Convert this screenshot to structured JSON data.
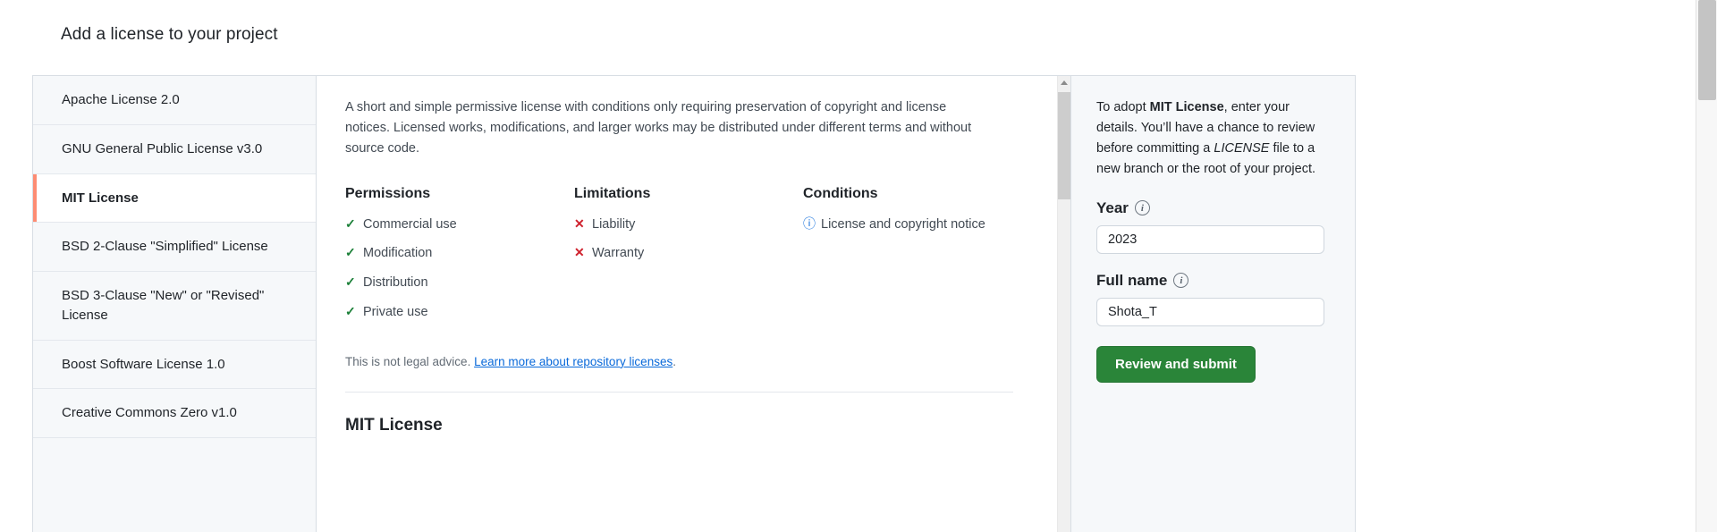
{
  "page": {
    "title": "Add a license to your project"
  },
  "license_list": {
    "items": [
      {
        "label": "Apache License 2.0",
        "selected": false
      },
      {
        "label": "GNU General Public License v3.0",
        "selected": false
      },
      {
        "label": "MIT License",
        "selected": true
      },
      {
        "label": "BSD 2-Clause \"Simplified\" License",
        "selected": false
      },
      {
        "label": "BSD 3-Clause \"New\" or \"Revised\" License",
        "selected": false
      },
      {
        "label": "Boost Software License 1.0",
        "selected": false
      },
      {
        "label": "Creative Commons Zero v1.0",
        "selected": false
      }
    ]
  },
  "detail": {
    "description": "A short and simple permissive license with conditions only requiring preservation of copyright and license notices. Licensed works, modifications, and larger works may be distributed under different terms and without source code.",
    "permissions": {
      "heading": "Permissions",
      "items": [
        "Commercial use",
        "Modification",
        "Distribution",
        "Private use"
      ],
      "mark": "✓"
    },
    "limitations": {
      "heading": "Limitations",
      "items": [
        "Liability",
        "Warranty"
      ],
      "mark": "✕"
    },
    "conditions": {
      "heading": "Conditions",
      "items": [
        "License and copyright notice"
      ],
      "mark": "ⓘ"
    },
    "legal_text": "This is not legal advice.",
    "legal_link": "Learn more about repository licenses",
    "legal_period": ".",
    "license_heading": "MIT License"
  },
  "adopt": {
    "intro_prefix": "To adopt ",
    "intro_license": "MIT License",
    "intro_middle": ", enter your details. You’ll have a chance to review before committing a ",
    "intro_file": "LICENSE",
    "intro_suffix": " file to a new branch or the root of your project.",
    "year_label": "Year",
    "year_value": "2023",
    "fullname_label": "Full name",
    "fullname_value": "Shota_T",
    "info_glyph": "i",
    "submit_label": "Review and submit"
  },
  "colors": {
    "accent_selected": "#fd8c73",
    "link": "#0969da",
    "success": "#1a7f37",
    "danger": "#cf222e",
    "button_green": "#2a8539"
  }
}
